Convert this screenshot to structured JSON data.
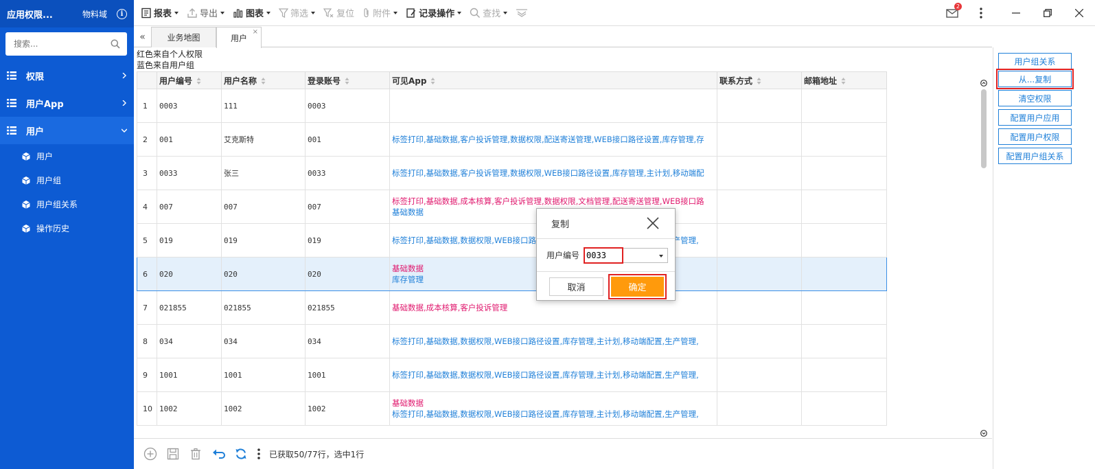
{
  "sidebar": {
    "title": "应用权限...",
    "subtitle": "物料域",
    "search_placeholder": "搜索...",
    "nav": [
      {
        "label": "权限"
      },
      {
        "label": "用户App"
      },
      {
        "label": "用户"
      }
    ],
    "sub_items": [
      {
        "label": "用户"
      },
      {
        "label": "用户组"
      },
      {
        "label": "用户组关系"
      },
      {
        "label": "操作历史"
      }
    ],
    "colors": {
      "bg": "#0d5bd3",
      "active": "#1a6ae0"
    }
  },
  "toolbar": {
    "report": "报表",
    "export": "导出",
    "chart": "图表",
    "filter": "筛选",
    "reset": "复位",
    "attachment": "附件",
    "record_ops": "记录操作",
    "find": "查找",
    "mail_badge": "2"
  },
  "tabs": {
    "collapse": "«",
    "items": [
      {
        "label": "业务地图"
      },
      {
        "label": "用户"
      }
    ],
    "close": "×"
  },
  "legend": {
    "line1": "红色来自个人权限",
    "line2": "蓝色来自用户组"
  },
  "grid": {
    "headers": [
      "",
      "用户编号",
      "用户名称",
      "登录账号",
      "可见App",
      "联系方式",
      "邮箱地址"
    ],
    "rows": [
      {
        "n": "1",
        "code": "0003",
        "name": "111",
        "login": "0003",
        "app1": "",
        "app1_color": "blue",
        "app2": "",
        "app2_color": "blue"
      },
      {
        "n": "2",
        "code": "001",
        "name": "艾克斯特",
        "login": "001",
        "app1": "标签打印,基础数据,客户投诉管理,数据权限,配送寄送管理,WEB接口路径设置,库存管理,存",
        "app1_color": "blue",
        "app2": "",
        "app2_color": "blue"
      },
      {
        "n": "3",
        "code": "0033",
        "name": "张三",
        "login": "0033",
        "app1": "标签打印,基础数据,客户投诉管理,数据权限,WEB接口路径设置,库存管理,主计划,移动端配",
        "app1_color": "blue",
        "app2": "",
        "app2_color": "blue"
      },
      {
        "n": "4",
        "code": "007",
        "name": "007",
        "login": "007",
        "app1": "标签打印,基础数据,成本核算,客户投诉管理,数据权限,文档管理,配送寄送管理,WEB接口路",
        "app1_color": "red",
        "app2": "基础数据",
        "app2_color": "blue"
      },
      {
        "n": "5",
        "code": "019",
        "name": "019",
        "login": "019",
        "app1": "标签打印,基础数据,数据权限,WEB接口路径设置,库存管理,主计划,移动端配置,生产管理,",
        "app1_color": "blue",
        "app2": "",
        "app2_color": "blue"
      },
      {
        "n": "6",
        "code": "020",
        "name": "020",
        "login": "020",
        "app1": "基础数据",
        "app1_color": "red",
        "app2": "库存管理",
        "app2_color": "blue"
      },
      {
        "n": "7",
        "code": "021855",
        "name": "021855",
        "login": "021855",
        "app1": "基础数据,成本核算,客户投诉管理",
        "app1_color": "red",
        "app2": "",
        "app2_color": "blue"
      },
      {
        "n": "8",
        "code": "034",
        "name": "034",
        "login": "034",
        "app1": "标签打印,基础数据,数据权限,WEB接口路径设置,库存管理,主计划,移动端配置,生产管理,",
        "app1_color": "blue",
        "app2": "",
        "app2_color": "blue"
      },
      {
        "n": "9",
        "code": "1001",
        "name": "1001",
        "login": "1001",
        "app1": "标签打印,基础数据,数据权限,WEB接口路径设置,库存管理,主计划,移动端配置,生产管理,",
        "app1_color": "blue",
        "app2": "",
        "app2_color": "blue"
      },
      {
        "n": "10",
        "code": "1002",
        "name": "1002",
        "login": "1002",
        "app1": "基础数据",
        "app1_color": "red",
        "app2": "标签打印,基础数据,数据权限,WEB接口路径设置,库存管理,主计划,移动端配置,生产管理,",
        "app2_color": "blue"
      }
    ],
    "selected_row": 6
  },
  "right_panel": {
    "buttons": [
      "用户组关系",
      "从...复制",
      "清空权限",
      "配置用户应用",
      "配置用户权限",
      "配置用户组关系"
    ]
  },
  "bottombar": {
    "status": "已获取50/77行，选中1行"
  },
  "dialog": {
    "title": "复制",
    "field_label": "用户编号",
    "field_value": "0033",
    "cancel": "取消",
    "ok": "确定"
  },
  "colors": {
    "blue_text": "#1e7fd8",
    "red_text": "#e0196e",
    "ok_button": "#ff9a0c",
    "highlight_border": "#e02020",
    "selected_row_bg": "#e4f0fb"
  }
}
